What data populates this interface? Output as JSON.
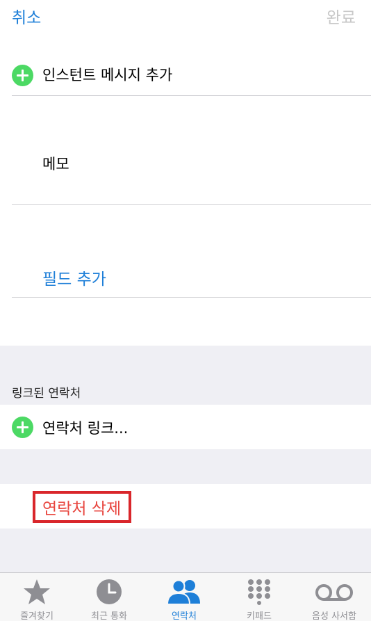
{
  "nav": {
    "cancel_label": "취소",
    "done_label": "완료"
  },
  "rows": {
    "add_instant_message": "인스턴트 메시지 추가",
    "memo": "메모",
    "add_field": "필드 추가"
  },
  "linked_contacts": {
    "header": "링크된 연락처",
    "link_label": "연락처 링크..."
  },
  "delete_contact_label": "연락처 삭제",
  "tabbar": {
    "tabs": [
      {
        "label": "즐겨찾기",
        "icon": "star-icon"
      },
      {
        "label": "최근 통화",
        "icon": "clock-icon"
      },
      {
        "label": "연락처",
        "icon": "contacts-icon",
        "active": true
      },
      {
        "label": "키패드",
        "icon": "keypad-icon"
      },
      {
        "label": "음성 사서함",
        "icon": "voicemail-icon"
      }
    ]
  },
  "colors": {
    "accent": "#1e7fd8",
    "add_green": "#4cd964",
    "delete_red": "#e8463f",
    "highlight_border": "#d9262b",
    "group_background": "#efeff4"
  }
}
